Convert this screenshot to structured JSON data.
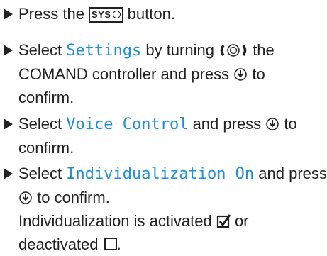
{
  "steps": [
    {
      "lines": [
        {
          "text_before": "Press the ",
          "key_label": "SYS",
          "text_after": " button."
        }
      ]
    },
    {
      "lines": [
        {
          "text_before": "Select ",
          "menu_item": "Settings",
          "text_after": " by turning ",
          "text_after2": " the"
        },
        {
          "text": "COMAND controller and press ",
          "text_after": " to"
        },
        {
          "text": "confirm."
        }
      ]
    },
    {
      "lines": [
        {
          "text_before": "Select ",
          "menu_item": "Voice Control",
          "text_after": " and press ",
          "text_after2": " to"
        },
        {
          "text": "confirm."
        }
      ]
    },
    {
      "lines": [
        {
          "text_before": "Select ",
          "menu_item": "Individualization On",
          "text_after": " and press"
        },
        {
          "text_after": " to confirm."
        },
        {
          "text": "Individualization is activated ",
          "text_after": " or"
        },
        {
          "text": "deactivated ",
          "text_after": "."
        }
      ]
    }
  ],
  "icons": {
    "bullet": "triangle-bullet-icon",
    "sys_clock": "clock-icon",
    "turn_controller": "turn-controller-icon",
    "press_controller": "press-controller-icon",
    "checked": "checkbox-checked-icon",
    "unchecked": "checkbox-empty-icon"
  },
  "colors": {
    "menu_text": "#1f8fd8",
    "body_text": "#222222"
  }
}
